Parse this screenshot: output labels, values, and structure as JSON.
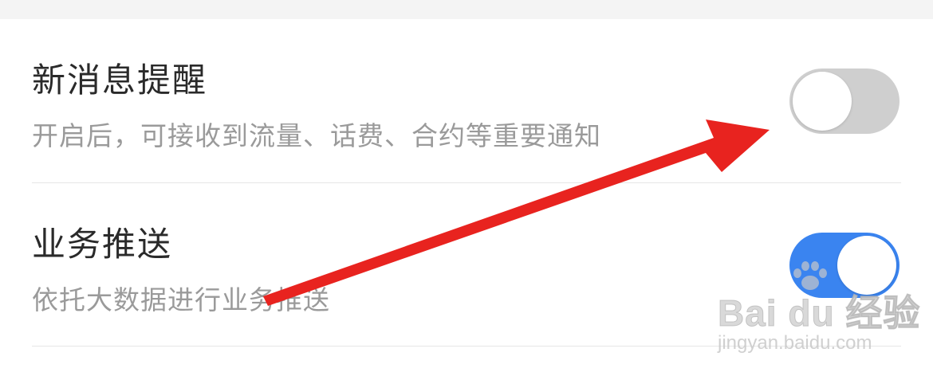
{
  "settings": {
    "new_message_alert": {
      "title": "新消息提醒",
      "description": "开启后，可接收到流量、话费、合约等重要通知",
      "enabled": false
    },
    "business_push": {
      "title": "业务推送",
      "description": "依托大数据进行业务推送",
      "enabled": true
    }
  },
  "colors": {
    "toggle_on": "#3a84f0",
    "toggle_off": "#cfcfcf",
    "annotation_arrow": "#e8231f"
  },
  "watermark": {
    "logo_text": "Bai du 经验",
    "url_text": "jingyan.baidu.com"
  }
}
